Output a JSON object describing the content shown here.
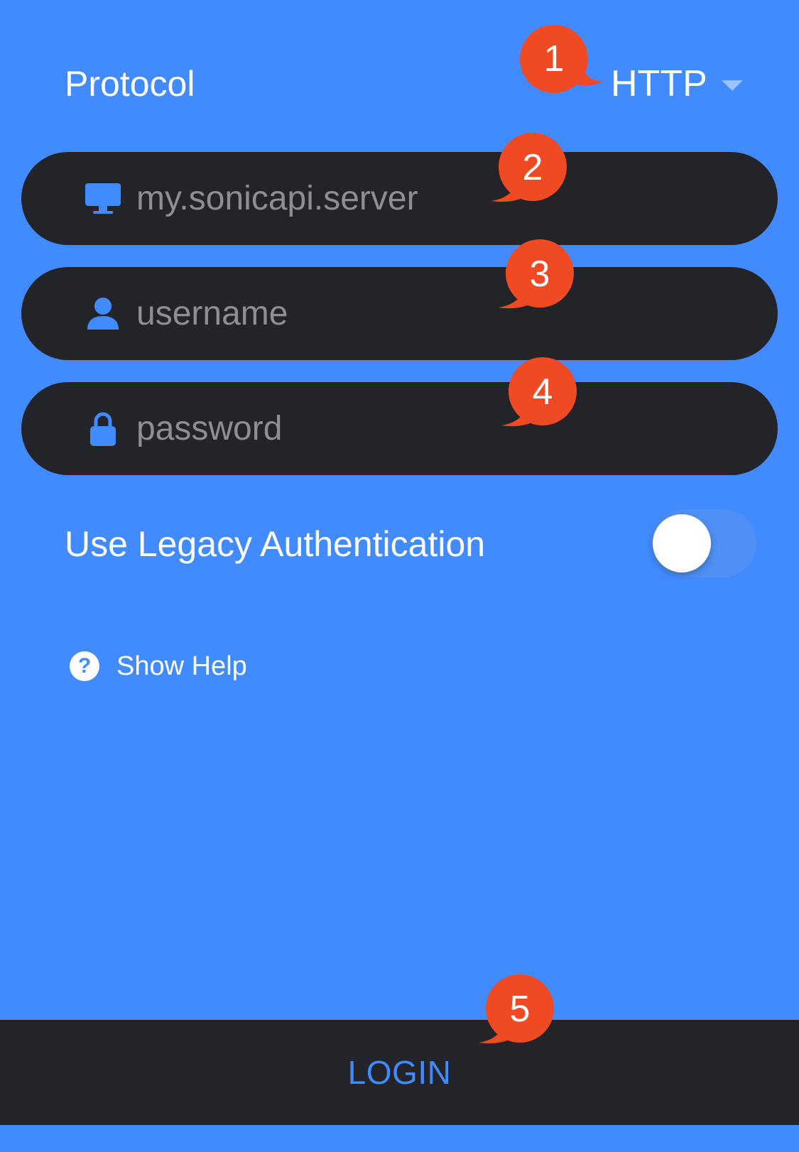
{
  "protocol": {
    "label": "Protocol",
    "value": "HTTP",
    "caret_icon": "chevron-down-icon"
  },
  "fields": {
    "server": {
      "placeholder": "my.sonicapi.server",
      "value": "",
      "icon": "monitor-icon"
    },
    "username": {
      "placeholder": "username",
      "value": "",
      "icon": "user-icon"
    },
    "password": {
      "placeholder": "password",
      "value": "",
      "icon": "lock-icon"
    }
  },
  "legacy_auth": {
    "label": "Use Legacy Authentication",
    "enabled": false
  },
  "help": {
    "label": "Show Help",
    "icon": "question-circle-icon"
  },
  "login": {
    "label": "LOGIN"
  },
  "callouts": [
    "1",
    "2",
    "3",
    "4",
    "5"
  ],
  "colors": {
    "background": "#428BFF",
    "field_background": "#232429",
    "placeholder": "#8E8E93",
    "callout": "#F04A24",
    "accent": "#428BFF"
  }
}
